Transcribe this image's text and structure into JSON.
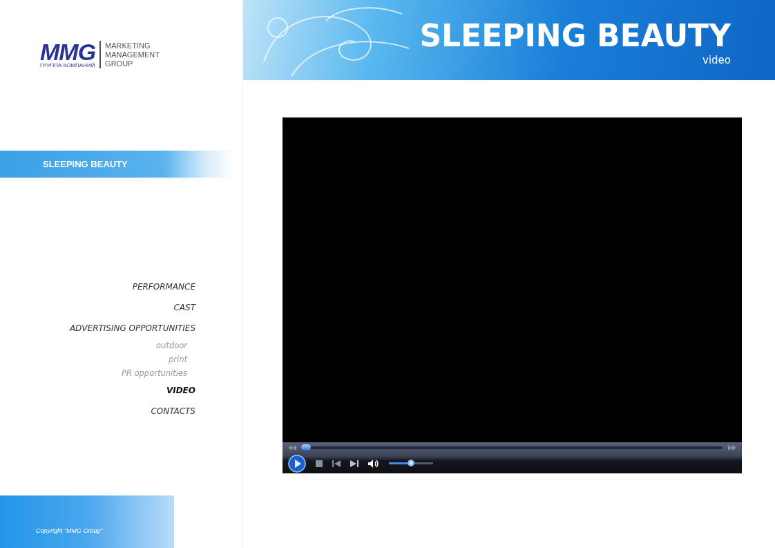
{
  "logo": {
    "mark": "MMG",
    "tagline": "ГРУППА КОМПАНИЙ",
    "lines": [
      "MARKETING",
      "MANAGEMENT",
      "GROUP"
    ]
  },
  "header": {
    "title": "SLEEPING BEAUTY",
    "subtitle": "video"
  },
  "section": {
    "title": "SLEEPING BEAUTY"
  },
  "nav": [
    {
      "label": "PERFORMANCE",
      "kind": "main",
      "selected": false
    },
    {
      "label": "CAST",
      "kind": "main",
      "selected": false
    },
    {
      "label": "ADVERTISING OPPORTUNITIES",
      "kind": "main",
      "selected": false
    },
    {
      "label": "outdoor",
      "kind": "sub",
      "selected": false
    },
    {
      "label": "print",
      "kind": "sub",
      "selected": false
    },
    {
      "label": "PR opportunities",
      "kind": "sub",
      "selected": false
    },
    {
      "label": "VIDEO",
      "kind": "main",
      "selected": true
    },
    {
      "label": "CONTACTS",
      "kind": "main",
      "selected": false
    }
  ],
  "player": {
    "seek": {
      "level": 0.01
    },
    "volume": {
      "level": 0.5
    }
  },
  "footer": {
    "copyright": "Copyright “MMG Group”"
  }
}
